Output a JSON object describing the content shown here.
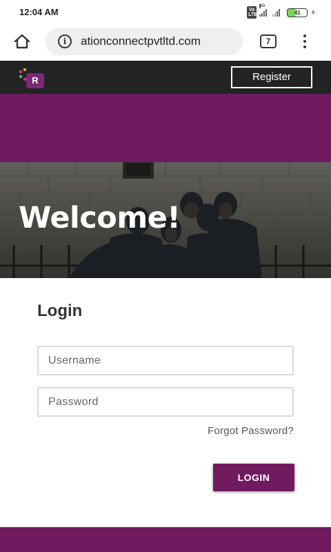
{
  "status_bar": {
    "time": "12:04 AM",
    "network": "4G",
    "volte": "Vo LTE",
    "battery": "41",
    "icons": [
      "volte-icon",
      "signal-icon",
      "signal-icon",
      "battery-icon",
      "charging-icon"
    ]
  },
  "browser": {
    "url": "ationconnectpvtltd.com",
    "tab_count": "7",
    "icons": [
      "home-icon",
      "info-icon",
      "tabs-icon",
      "more-vert-icon"
    ]
  },
  "site_header": {
    "logo_letter": "R",
    "register_label": "Register"
  },
  "hero": {
    "title": "Welcome!"
  },
  "login": {
    "title": "Login",
    "username_placeholder": "Username",
    "username_value": "",
    "password_placeholder": "Password",
    "password_value": "",
    "forgot_label": "Forgot Password?",
    "submit_label": "LOGIN"
  },
  "colors": {
    "brand_purple": "#701a5f",
    "header_dark": "#222423",
    "logo_purple": "#7a2a73",
    "battery_green": "#7bd35a"
  }
}
